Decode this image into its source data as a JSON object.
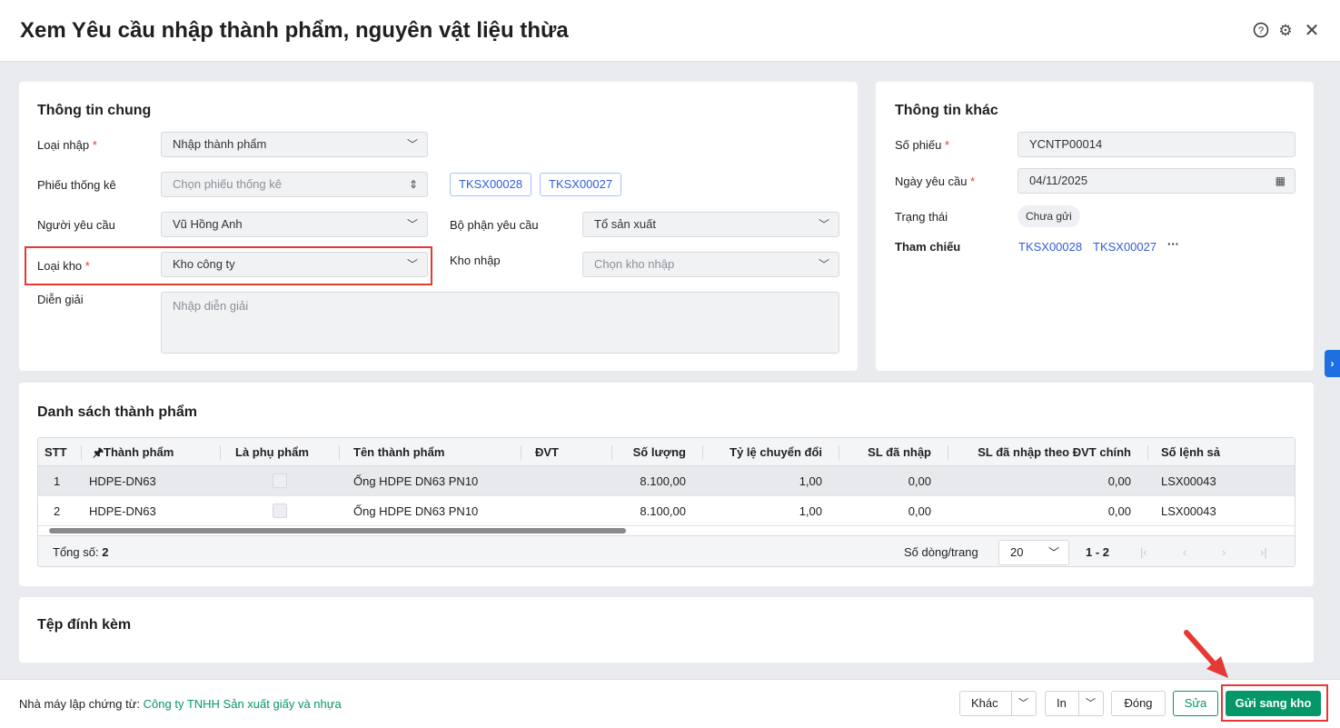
{
  "title": "Xem Yêu cầu nhập thành phẩm, nguyên vật liệu thừa",
  "header_icons": [
    "help-icon",
    "gear-icon",
    "close-icon"
  ],
  "general": {
    "heading": "Thông tin chung",
    "loai_nhap": {
      "label": "Loại nhập",
      "value": "Nhập thành phẩm"
    },
    "phieu_thong_ke": {
      "label": "Phiếu thống kê",
      "placeholder": "Chọn phiếu thống kê",
      "tags": [
        "TKSX00028",
        "TKSX00027"
      ]
    },
    "nguoi_yeu_cau": {
      "label": "Người yêu cầu",
      "value": "Vũ Hồng Anh"
    },
    "bo_phan": {
      "label": "Bộ phận yêu cầu",
      "value": "Tổ sản xuất"
    },
    "loai_kho": {
      "label": "Loại kho",
      "value": "Kho công ty"
    },
    "kho_nhap": {
      "label": "Kho nhập",
      "placeholder": "Chọn kho nhập"
    },
    "dien_giai": {
      "label": "Diễn giải",
      "placeholder": "Nhập diễn giải"
    }
  },
  "other": {
    "heading": "Thông tin khác",
    "so_phieu": {
      "label": "Số phiếu",
      "value": "YCNTP00014"
    },
    "ngay": {
      "label": "Ngày yêu cầu",
      "value": "04/11/2025"
    },
    "trang_thai": {
      "label": "Trạng thái",
      "value": "Chưa gửi"
    },
    "tham_chieu": {
      "label": "Tham chiếu",
      "links": [
        "TKSX00028",
        "TKSX00027"
      ],
      "more": "···"
    }
  },
  "products": {
    "heading": "Danh sách thành phẩm",
    "columns": [
      "STT",
      "Thành phẩm",
      "Là phụ phẩm",
      "Tên thành phẩm",
      "ĐVT",
      "Số lượng",
      "Tỷ lệ chuyển đổi",
      "SL đã nhập",
      "SL đã nhập theo ĐVT chính",
      "Số lệnh sả"
    ],
    "rows": [
      {
        "stt": "1",
        "code": "HDPE-DN63",
        "name": "Ống HDPE DN63 PN10",
        "dvt": "",
        "qty": "8.100,00",
        "ratio": "1,00",
        "imported": "0,00",
        "imported_main": "0,00",
        "order": "LSX00043"
      },
      {
        "stt": "2",
        "code": "HDPE-DN63",
        "name": "Ống HDPE DN63 PN10",
        "dvt": "",
        "qty": "8.100,00",
        "ratio": "1,00",
        "imported": "0,00",
        "imported_main": "0,00",
        "order": "LSX00043"
      }
    ],
    "total_label": "Tổng số:",
    "total": "2",
    "page_size_label": "Số dòng/trang",
    "page_size": "20",
    "range": "1 - 2"
  },
  "attachments": {
    "heading": "Tệp đính kèm"
  },
  "footer": {
    "company_label": "Nhà máy lập chứng từ:",
    "company": "Công ty TNHH Sản xuất giấy và nhựa",
    "khac": "Khác",
    "in": "In",
    "dong": "Đóng",
    "sua": "Sửa",
    "gui": "Gửi sang kho"
  },
  "colors": {
    "accent": "#059669",
    "link": "#3559d9",
    "highlight": "#e53935"
  }
}
